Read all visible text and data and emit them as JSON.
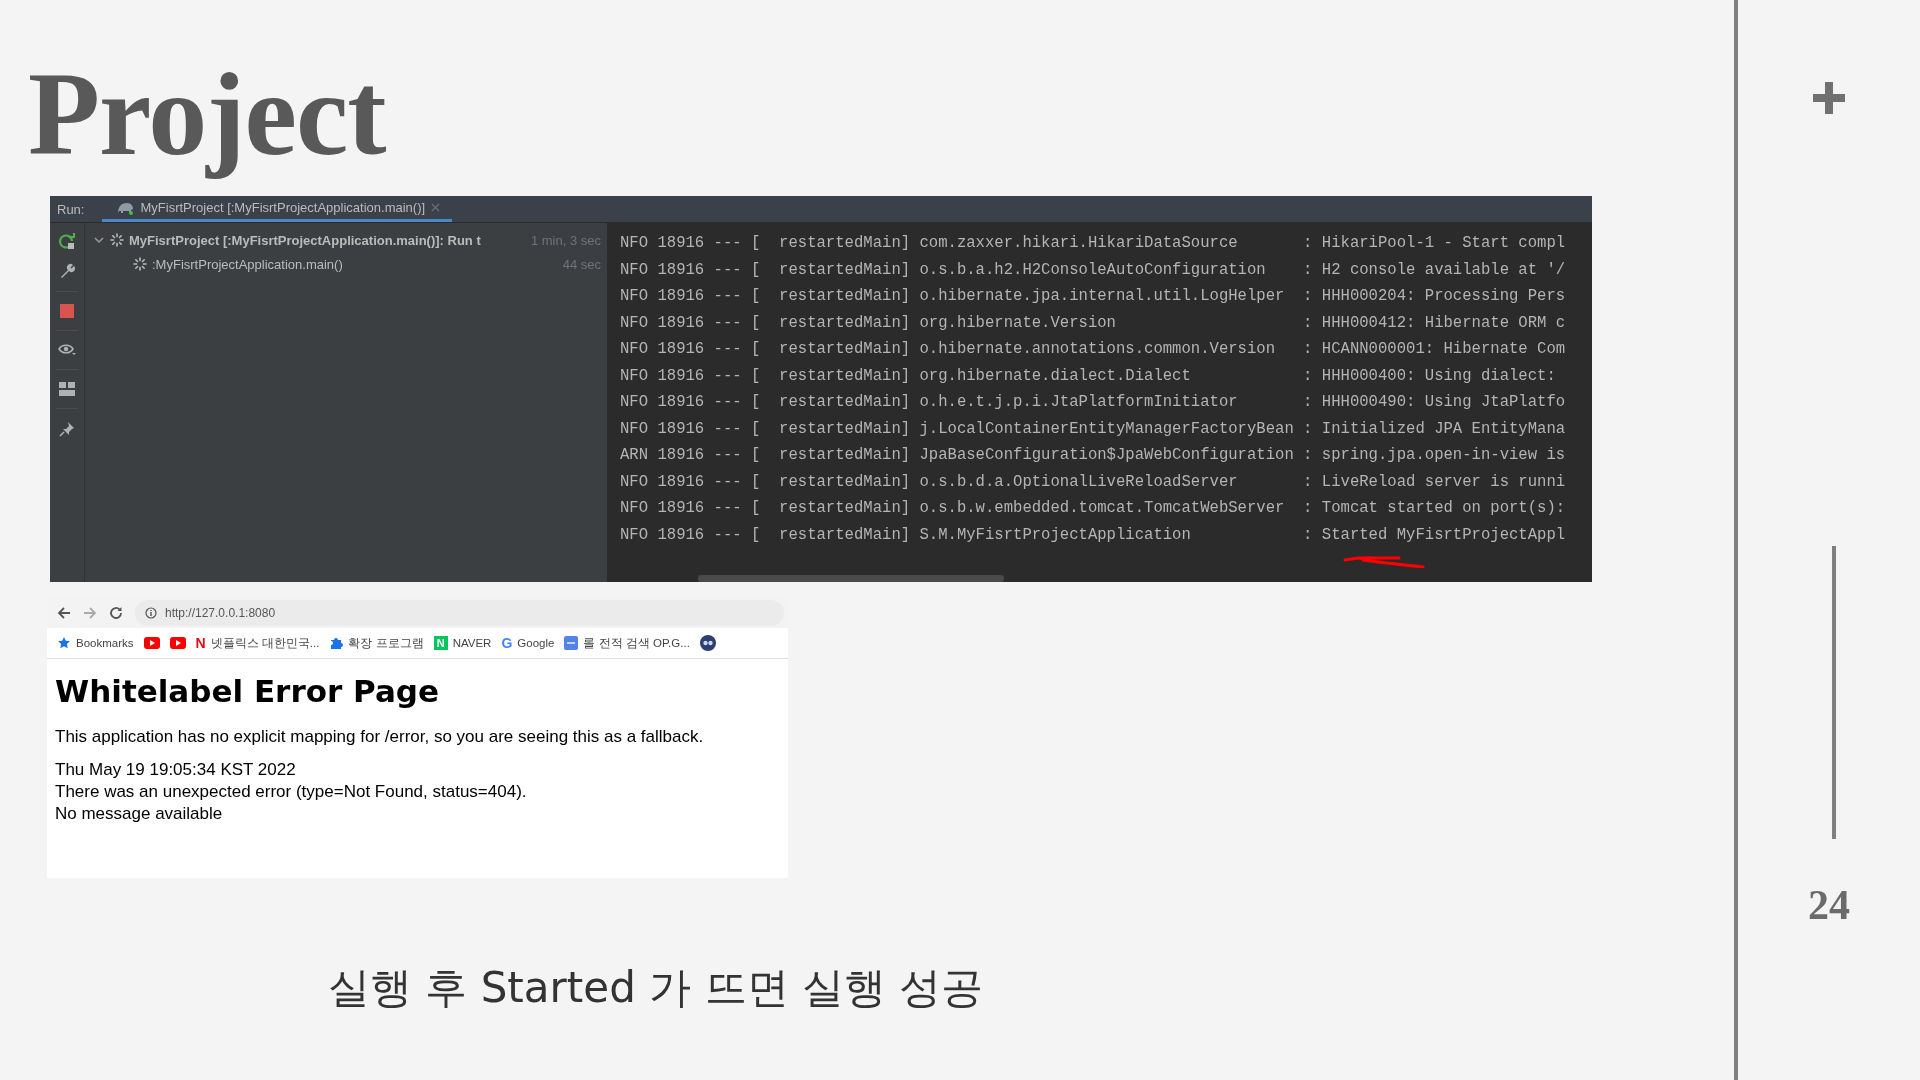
{
  "slide": {
    "title": "Project",
    "caption": "실행 후 Started 가 뜨면 실행 성공",
    "page_number": "24"
  },
  "run_panel": {
    "label": "Run:",
    "tabs": [
      {
        "title": "MyFisrtProject [:MyFisrtProjectApplication.main()]",
        "selected": true
      }
    ],
    "tree": [
      {
        "label": "MyFisrtProject [:MyFisrtProjectApplication.main()]: Run t",
        "time": "1 min, 3 sec",
        "expanded": true,
        "children": [
          {
            "label": ":MyFisrtProjectApplication.main()",
            "time": "44 sec"
          }
        ]
      }
    ],
    "log_lines": [
      "NFO 18916 --- [  restartedMain] com.zaxxer.hikari.HikariDataSource       : HikariPool-1 - Start compl",
      "NFO 18916 --- [  restartedMain] o.s.b.a.h2.H2ConsoleAutoConfiguration    : H2 console available at '/",
      "NFO 18916 --- [  restartedMain] o.hibernate.jpa.internal.util.LogHelper  : HHH000204: Processing Pers",
      "NFO 18916 --- [  restartedMain] org.hibernate.Version                    : HHH000412: Hibernate ORM c",
      "NFO 18916 --- [  restartedMain] o.hibernate.annotations.common.Version   : HCANN000001: Hibernate Com",
      "NFO 18916 --- [  restartedMain] org.hibernate.dialect.Dialect            : HHH000400: Using dialect:",
      "NFO 18916 --- [  restartedMain] o.h.e.t.j.p.i.JtaPlatformInitiator       : HHH000490: Using JtaPlatfo",
      "NFO 18916 --- [  restartedMain] j.LocalContainerEntityManagerFactoryBean : Initialized JPA EntityMana",
      "ARN 18916 --- [  restartedMain] JpaBaseConfiguration$JpaWebConfiguration : spring.jpa.open-in-view is",
      "NFO 18916 --- [  restartedMain] o.s.b.d.a.OptionalLiveReloadServer       : LiveReload server is runni",
      "NFO 18916 --- [  restartedMain] o.s.b.w.embedded.tomcat.TomcatWebServer  : Tomcat started on port(s):",
      "NFO 18916 --- [  restartedMain] S.M.MyFisrtProjectApplication            : Started MyFisrtProjectAppl"
    ]
  },
  "browser": {
    "url": "http://127.0.0.1:8080",
    "bookmarks": [
      {
        "kind": "star",
        "label": "Bookmarks"
      },
      {
        "kind": "video"
      },
      {
        "kind": "video"
      },
      {
        "kind": "glyph",
        "glyph": "N",
        "color": "#e50914",
        "label": "넷플릭스 대한민국..."
      },
      {
        "kind": "puzzle",
        "label": "확장 프로그램"
      },
      {
        "kind": "tile",
        "glyph": "N",
        "color": "#03c75a",
        "label": "NAVER"
      },
      {
        "kind": "glyph",
        "glyph": "G",
        "color": "#4285f4",
        "label": "Google"
      },
      {
        "kind": "square",
        "label": "롤 전적 검색 OP.G..."
      },
      {
        "kind": "round"
      }
    ],
    "page": {
      "heading": "Whitelabel Error Page",
      "paragraph": "This application has no explicit mapping for /error, so you are seeing this as a fallback.",
      "details": [
        "Thu May 19 19:05:34 KST 2022",
        "There was an unexpected error (type=Not Found, status=404).",
        "No message available"
      ]
    }
  }
}
